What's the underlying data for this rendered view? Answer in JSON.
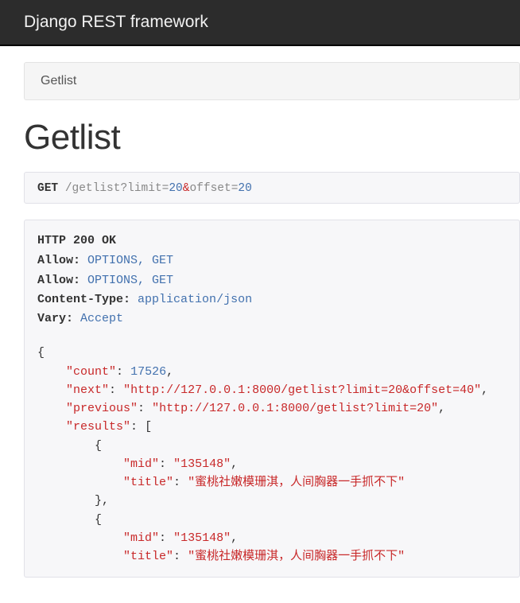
{
  "navbar": {
    "brand": "Django REST framework"
  },
  "breadcrumb": {
    "label": "Getlist"
  },
  "page": {
    "title": "Getlist"
  },
  "request": {
    "method": "GET",
    "path": "/getlist",
    "query_raw": "?limit=20&offset=20",
    "query_parts": {
      "q1_key": "limit",
      "q1_val": "20",
      "q2_key": "offset",
      "q2_val": "20"
    }
  },
  "response": {
    "status": "HTTP 200 OK",
    "headers": [
      {
        "key": "Allow:",
        "value": "OPTIONS, GET"
      },
      {
        "key": "Allow:",
        "value": "OPTIONS, GET"
      },
      {
        "key": "Content-Type:",
        "value": "application/json"
      },
      {
        "key": "Vary:",
        "value": "Accept"
      }
    ],
    "body": {
      "count": 17526,
      "next": "http://127.0.0.1:8000/getlist?limit=20&offset=40",
      "previous": "http://127.0.0.1:8000/getlist?limit=20",
      "results": [
        {
          "mid": "135148",
          "title": "蜜桃社嫩模珊淇，人间胸器一手抓不下"
        },
        {
          "mid": "135148",
          "title": "蜜桃社嫩模珊淇，人间胸器一手抓不下"
        }
      ]
    }
  }
}
